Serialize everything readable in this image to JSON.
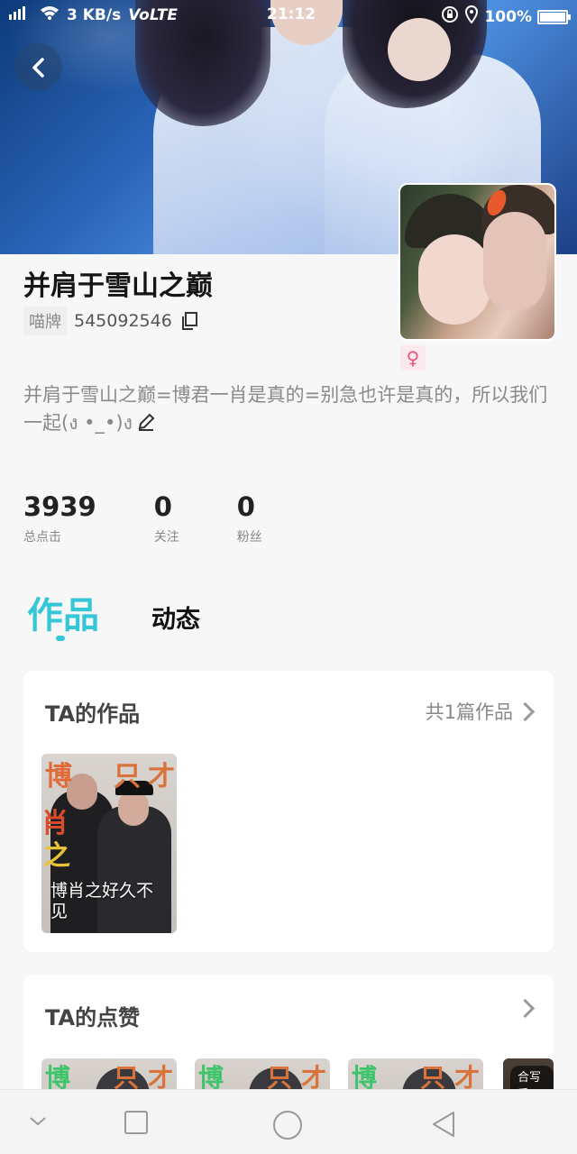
{
  "status_bar": {
    "network": "3 KB/s",
    "volte": "VoLTE",
    "time": "21:12",
    "battery": "100%",
    "battery_level": 1.0
  },
  "profile": {
    "name": "并肩于雪山之巅",
    "id_tag": "喵牌",
    "id_number": "545092546",
    "gender_symbol": "♀",
    "bio": "并肩于雪山之巅=博君一肖是真的=别急也许是真的，所以我们一起(ง •_•)ง"
  },
  "stats": [
    {
      "value": "3939",
      "label": "总点击"
    },
    {
      "value": "0",
      "label": "关注"
    },
    {
      "value": "0",
      "label": "粉丝"
    }
  ],
  "tabs": {
    "active": "作品",
    "other": "动态"
  },
  "works_section": {
    "title": "TA的作品",
    "count_label": "共1篇作品",
    "items": [
      {
        "title": "博肖之好久不见"
      }
    ]
  },
  "likes_section": {
    "title": "TA的点赞",
    "badge": "合写番"
  },
  "colors": {
    "accent": "#35c6d8",
    "gender": "#e8587a"
  },
  "icons": [
    "back-icon",
    "copy-icon",
    "edit-icon",
    "chevron-right-icon",
    "nav-down-icon",
    "nav-square-icon",
    "nav-circle-icon",
    "nav-back-triangle-icon"
  ]
}
